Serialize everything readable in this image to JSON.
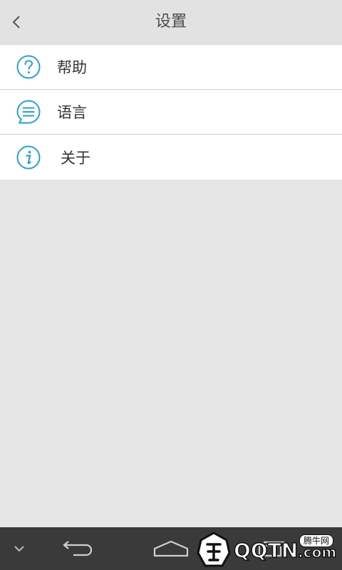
{
  "header": {
    "title": "设置",
    "back_icon": "chevron-left-icon"
  },
  "settings": {
    "items": [
      {
        "label": "帮助",
        "icon": "help-icon"
      },
      {
        "label": "语言",
        "icon": "language-icon"
      },
      {
        "label": "关于",
        "icon": "info-icon"
      }
    ]
  },
  "navbar": {
    "icons": [
      "chevron-down-icon",
      "back-arrow-icon",
      "home-icon",
      "recent-apps-icon"
    ]
  },
  "watermark": {
    "text": "QQTN",
    "suffix": ".com",
    "badge": "腾牛网"
  },
  "colors": {
    "accent": "#2b9fc9",
    "header_bg": "#e2e2e2",
    "page_bg": "#e6e6e6",
    "navbar_bg": "#3a3a3a"
  }
}
